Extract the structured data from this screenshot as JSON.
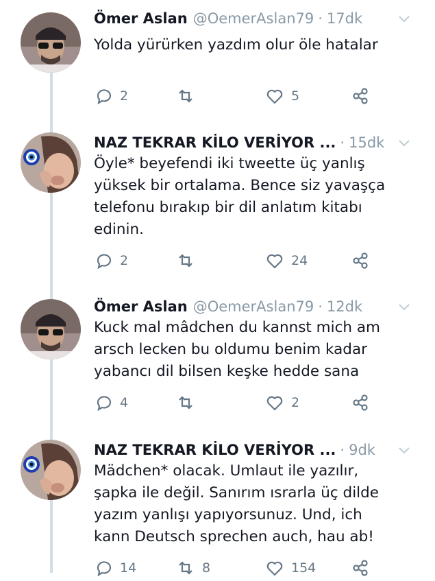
{
  "tweets": [
    {
      "name": "Ömer Aslan",
      "handle": "@OemerAslan79",
      "separator": "·",
      "time": "17dk",
      "text": "Yolda yürürken yazdım olur öle hatalar",
      "replies": "2",
      "retweets": "",
      "likes": "5",
      "avatar": "man-with-cap"
    },
    {
      "name": "NAZ TEKRAR KİLO VERİYOR ...",
      "handle": "",
      "separator": "·",
      "time": "15dk",
      "text": "Öyle* beyefendi iki tweette üç yanlış\nyüksek bir ortalama. Bence siz yavaşça\ntelefonu bırakıp bir dil anlatım kitabı\nedinin.",
      "replies": "2",
      "retweets": "",
      "likes": "24",
      "avatar": "woman-with-evil-eye"
    },
    {
      "name": "Ömer Aslan",
      "handle": "@OemerAslan79",
      "separator": "·",
      "time": "12dk",
      "text": "Kuck mal mâdchen du kannst mich am\narsch lecken bu oldumu benim kadar\nyabancı dil bilsen keşke hedde sana",
      "replies": "4",
      "retweets": "",
      "likes": "2",
      "avatar": "man-with-cap"
    },
    {
      "name": "NAZ TEKRAR KİLO VERİYOR ...",
      "handle": "",
      "separator": "·",
      "time": "9dk",
      "text": "Mädchen* olacak. Umlaut ile yazılır,\nşapka ile değil. Sanırım ısrarla üç dilde\nyazım yanlışı yapıyorsunuz. Und, ich\nkann Deutsch sprechen auch, hau ab!",
      "replies": "14",
      "retweets": "8",
      "likes": "154",
      "avatar": "woman-with-evil-eye"
    }
  ],
  "colors": {
    "text": "#141823",
    "muted": "#8899a6",
    "icon": "#657786",
    "thread_line": "#d3dde3"
  }
}
